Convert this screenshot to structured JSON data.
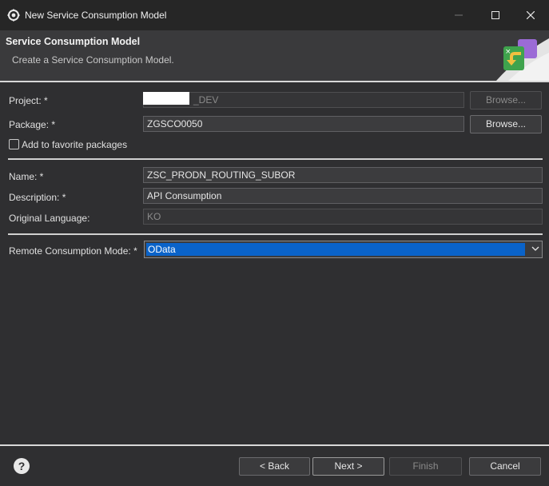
{
  "window": {
    "title": "New Service Consumption Model",
    "icon": "eclipse-gear-icon"
  },
  "header": {
    "title": "Service Consumption Model",
    "subtitle": "Create a Service Consumption Model."
  },
  "form": {
    "project": {
      "label": "Project: *",
      "value": "_DEV",
      "browse_label": "Browse..."
    },
    "package": {
      "label": "Package: *",
      "value": "ZGSCO0050",
      "browse_label": "Browse..."
    },
    "favorite": {
      "label": "Add to favorite packages",
      "checked": false
    },
    "name": {
      "label": "Name: *",
      "value": "ZSC_PRODN_ROUTING_SUBOR"
    },
    "description": {
      "label": "Description: *",
      "value": "API Consumption"
    },
    "language": {
      "label": "Original Language:",
      "value": "KO"
    },
    "mode": {
      "label": "Remote Consumption Mode: *",
      "value": "OData"
    }
  },
  "footer": {
    "help_icon": "?",
    "back_label": "< Back",
    "next_label": "Next >",
    "finish_label": "Finish",
    "cancel_label": "Cancel"
  },
  "colors": {
    "selection": "#0a63c9",
    "background": "#2f2f31"
  }
}
